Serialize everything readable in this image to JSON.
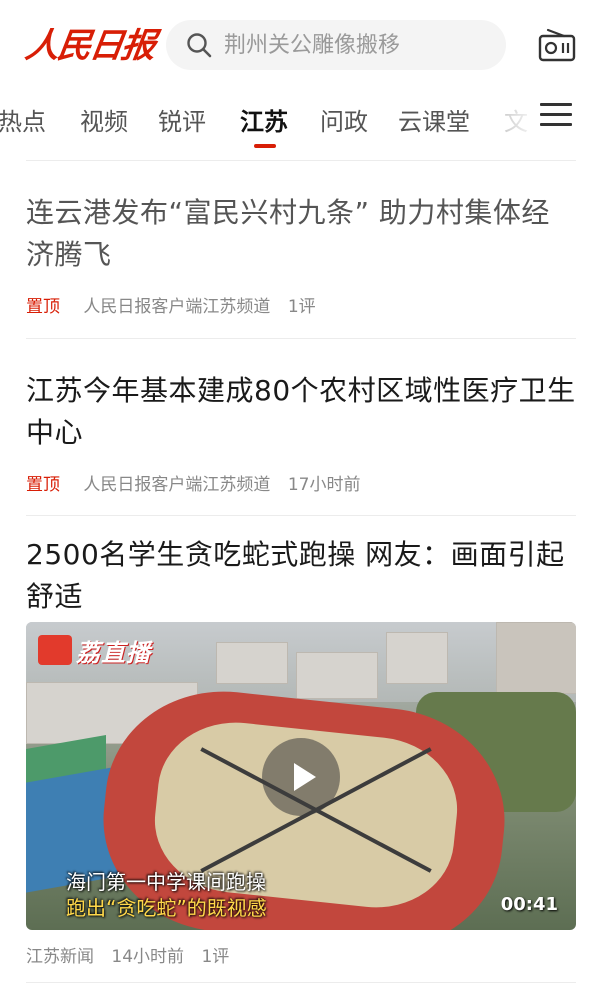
{
  "header": {
    "logo_text": "人民日报",
    "search_placeholder": "荆州关公雕像搬移",
    "search_icon": "search-icon",
    "radio_icon": "radio-icon"
  },
  "tabs": {
    "items": [
      "热点",
      "视频",
      "锐评",
      "江苏",
      "问政",
      "云课堂",
      "文"
    ],
    "active": "江苏",
    "menu_icon": "hamburger-menu-icon"
  },
  "articles": [
    {
      "title": "连云港发布“富民兴村九条” 助力村集体经济腾飞",
      "pin": "置顶",
      "source": "人民日报客户端江苏频道",
      "extra": "1评"
    },
    {
      "title": "江苏今年基本建成80个农村区域性医疗卫生中心",
      "pin": "置顶",
      "source": "人民日报客户端江苏频道",
      "extra": "17小时前"
    },
    {
      "title": "2500名学生贪吃蛇式跑操 网友：画面引起舒适",
      "source": "江苏新闻",
      "time": "14小时前",
      "comments": "1评",
      "video": {
        "logo_text": "荔直播",
        "caption_line1": "海门第一中学课间跑操",
        "caption_line2": "跑出“贪吃蛇”的既视感",
        "duration": "00:41",
        "play_icon": "play-icon"
      }
    }
  ],
  "colors": {
    "brand_red": "#d81e06",
    "caption_yellow": "#ffd84a"
  }
}
